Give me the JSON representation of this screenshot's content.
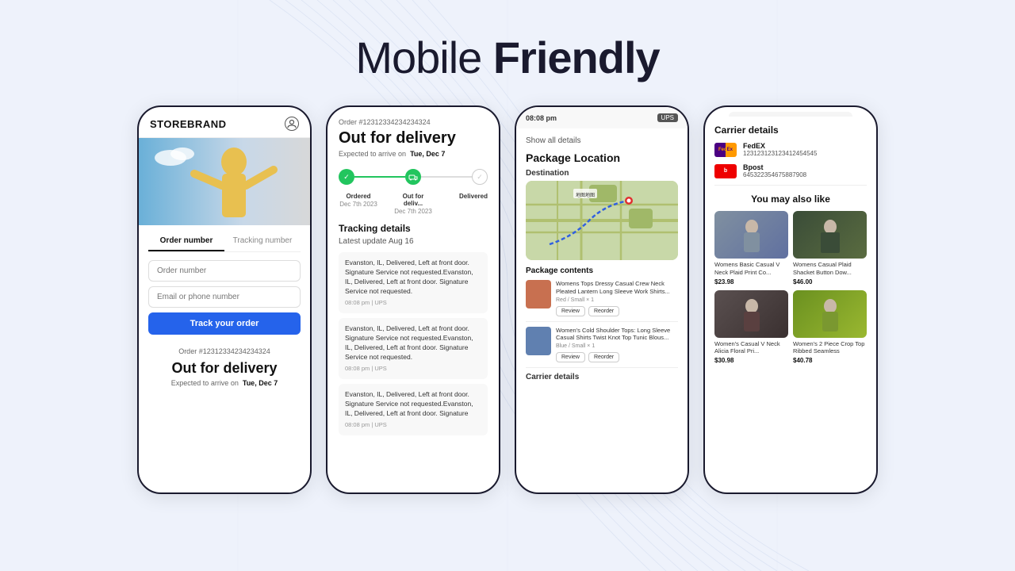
{
  "page": {
    "background": "#eef2fb"
  },
  "header": {
    "title_normal": "Mobile ",
    "title_bold": "Friendly"
  },
  "phone1": {
    "brand": "STOREBRAND",
    "user_icon": "👤",
    "tabs": [
      "Order number",
      "Tracking number"
    ],
    "order_input_placeholder": "Order number",
    "email_input_placeholder": "Email or phone number",
    "track_button": "Track your order",
    "order_number": "Order #12312334234234324",
    "status": "Out for delivery",
    "expected_label": "Expected to arrive on",
    "expected_date": "Tue, Dec 7"
  },
  "phone2": {
    "order_number": "Order #12312334234234324",
    "status_title": "Out for delivery",
    "expected_label": "Expected to arrive on",
    "expected_date": "Tue, Dec 7",
    "steps": [
      {
        "label": "Ordered",
        "date": "Dec 7th 2023",
        "state": "done"
      },
      {
        "label": "Out for deliv...",
        "date": "Dec 7th 2023",
        "state": "active"
      },
      {
        "label": "Delivered",
        "date": "",
        "state": "pending"
      }
    ],
    "tracking_section": "Tracking details",
    "latest_update": "Latest update Aug 16",
    "tracking_items": [
      {
        "text": "Evanston, IL, Delivered, Left at front door. Signature Service not requested.Evanston, IL, Delivered, Left at front door. Signature Service not requested.",
        "meta": "08:08 pm  |  UPS"
      },
      {
        "text": "Evanston, IL, Delivered, Left at front door. Signature Service not requested.Evanston, IL, Delivered, Left at front door. Signature Service not requested.",
        "meta": "08:08 pm  |  UPS"
      },
      {
        "text": "Evanston, IL, Delivered, Left at front door. Signature Service not requested.Evanston, IL, Delivered, Left at front door. Signature",
        "meta": "08:08 pm  |  UPS"
      }
    ]
  },
  "phone3": {
    "time": "08:08 pm",
    "carrier": "UPS",
    "show_all": "Show all details",
    "section_title": "Package Location",
    "destination_label": "Destination",
    "package_contents_label": "Package contents",
    "products": [
      {
        "name": "Womens Tops Dressy Casual Crew Neck Pleated Lantern Long Sleeve Work Shirts...",
        "variant": "Red / Small  × 1",
        "color": "red",
        "btns": [
          "Review",
          "Reorder"
        ]
      },
      {
        "name": "Women's Cold Shoulder Tops: Long Sleeve Casual Shirts Twist Knot Top Tunic Blous...",
        "variant": "Blue / Small  × 1",
        "color": "blue",
        "btns": [
          "Review",
          "Reorder"
        ]
      }
    ],
    "carrier_details_label": "Carrier details"
  },
  "phone4": {
    "carrier_details_title": "Carrier details",
    "carriers": [
      {
        "name": "FedEX",
        "tracking": "123123123123412454545",
        "logo_type": "fedex"
      },
      {
        "name": "Bpost",
        "tracking": "645322354675887908",
        "logo_type": "bpost"
      }
    ],
    "you_may_like": "You may also like",
    "products": [
      {
        "name": "Womens Basic Casual V Neck Plaid Print Co...",
        "price": "$23.98",
        "color": "gray"
      },
      {
        "name": "Womens Casual Plaid Shacket Button Dow...",
        "price": "$46.00",
        "color": "green"
      },
      {
        "name": "Women's Casual V Neck Alicia Floral Pri...",
        "price": "$30.98",
        "color": "dark"
      },
      {
        "name": "Women's 2 Piece Crop Top Ribbed Seamless",
        "price": "$40.78",
        "color": "lime"
      }
    ]
  }
}
